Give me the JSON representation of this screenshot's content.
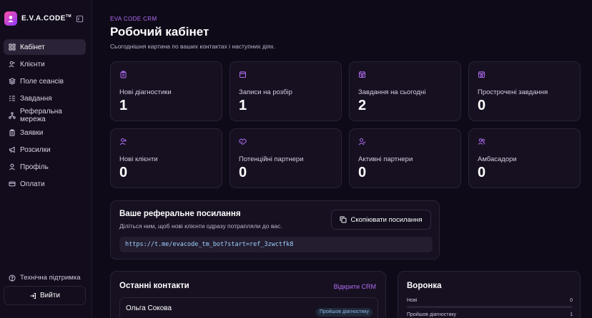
{
  "brand": {
    "name": "E.V.A.CODE",
    "mark": "TM"
  },
  "sidebar": {
    "items": [
      {
        "label": "Кабінет",
        "icon": "dashboard-icon",
        "active": true
      },
      {
        "label": "Клієнти",
        "icon": "users-icon"
      },
      {
        "label": "Поле сеансів",
        "icon": "layers-icon"
      },
      {
        "label": "Завдання",
        "icon": "tasks-icon"
      },
      {
        "label": "Реферальна мережа",
        "icon": "network-icon"
      },
      {
        "label": "Заявки",
        "icon": "clipboard-icon"
      },
      {
        "label": "Розсилки",
        "icon": "megaphone-icon"
      },
      {
        "label": "Профіль",
        "icon": "user-icon"
      },
      {
        "label": "Оплати",
        "icon": "card-icon"
      }
    ],
    "support": "Технічна підтримка",
    "logout": "Вийти"
  },
  "header": {
    "eyebrow": "EVA CODE CRM",
    "title": "Робочий кабінет",
    "subtitle": "Сьогоднішня картина по ваших контактах і наступних діях."
  },
  "stats": [
    {
      "label": "Нові діагностики",
      "value": "1",
      "icon": "clipboard-icon"
    },
    {
      "label": "Записи на розбір",
      "value": "1",
      "icon": "calendar-icon"
    },
    {
      "label": "Завдання на сьогодні",
      "value": "2",
      "icon": "calendar-clock-icon"
    },
    {
      "label": "Прострочені завдання",
      "value": "0",
      "icon": "calendar-clock-icon"
    },
    {
      "label": "Нові клієнти",
      "value": "0",
      "icon": "user-plus-icon"
    },
    {
      "label": "Потенційні партнери",
      "value": "0",
      "icon": "handshake-icon"
    },
    {
      "label": "Активні партнери",
      "value": "0",
      "icon": "user-check-icon"
    },
    {
      "label": "Амбасадори",
      "value": "0",
      "icon": "users-icon"
    }
  ],
  "referral": {
    "title": "Ваше реферальне посилання",
    "description": "Діліться ним, щоб нові клієнти одразу потрапляли до вас.",
    "copy_label": "Скопіювати посилання",
    "link": "https://t.me/evacode_tm_bot?start=ref_3zwctfk8"
  },
  "contacts": {
    "title": "Останні контакти",
    "open_crm": "Відкрити CRM",
    "items": [
      {
        "name": "Ольга Сокова",
        "status": "Пройшов діагностику"
      }
    ]
  },
  "funnel": {
    "title": "Воронка",
    "rows": [
      {
        "label": "Нові",
        "count": "0",
        "fill": 0
      },
      {
        "label": "Пройшов діагностику",
        "count": "1",
        "fill": 1
      }
    ]
  },
  "colors": {
    "accent": "#b06cf3",
    "background": "#0f0a18",
    "card": "#171021"
  }
}
